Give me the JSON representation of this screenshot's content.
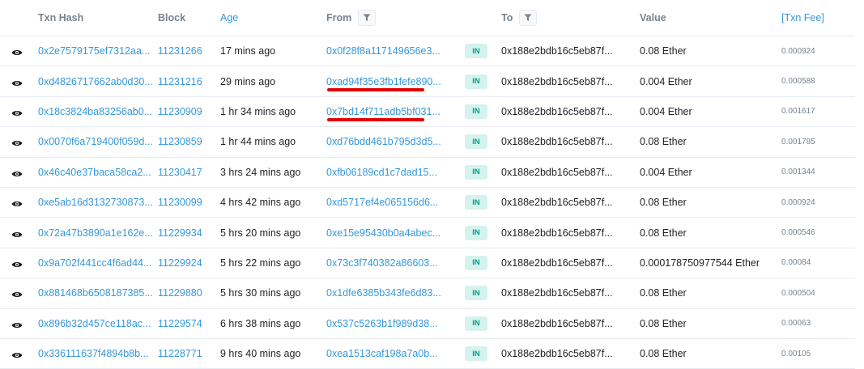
{
  "headers": {
    "txn_hash": "Txn Hash",
    "block": "Block",
    "age": "Age",
    "from": "From",
    "to": "To",
    "value": "Value",
    "txn_fee": "[Txn Fee]"
  },
  "colors": {
    "link": "#3498db",
    "in_badge_bg": "#d5f3ee",
    "in_badge_text": "#00a186",
    "annotation_red": "#e00000"
  },
  "rows": [
    {
      "hash": "0x2e7579175ef7312aa...",
      "block": "11231266",
      "age": "17 mins ago",
      "from": "0x0f28f8a117149656e3...",
      "direction": "IN",
      "to": "0x188e2bdb16c5eb87f...",
      "value": "0.08 Ether",
      "fee": "0.000924",
      "highlighted": false
    },
    {
      "hash": "0xd4826717662ab0d30...",
      "block": "11231216",
      "age": "29 mins ago",
      "from": "0xad94f35e3fb1fefe890...",
      "direction": "IN",
      "to": "0x188e2bdb16c5eb87f...",
      "value": "0.004 Ether",
      "fee": "0.000588",
      "highlighted": true
    },
    {
      "hash": "0x18c3824ba83256ab0...",
      "block": "11230909",
      "age": "1 hr 34 mins ago",
      "from": "0x7bd14f711adb5bf031...",
      "direction": "IN",
      "to": "0x188e2bdb16c5eb87f...",
      "value": "0.004 Ether",
      "fee": "0.001617",
      "highlighted": true
    },
    {
      "hash": "0x0070f6a719400f059d...",
      "block": "11230859",
      "age": "1 hr 44 mins ago",
      "from": "0xd76bdd461b795d3d5...",
      "direction": "IN",
      "to": "0x188e2bdb16c5eb87f...",
      "value": "0.08 Ether",
      "fee": "0.001785",
      "highlighted": false
    },
    {
      "hash": "0x46c40e37baca58ca2...",
      "block": "11230417",
      "age": "3 hrs 24 mins ago",
      "from": "0xfb06189cd1c7dad15...",
      "direction": "IN",
      "to": "0x188e2bdb16c5eb87f...",
      "value": "0.004 Ether",
      "fee": "0.001344",
      "highlighted": false
    },
    {
      "hash": "0xe5ab16d3132730873...",
      "block": "11230099",
      "age": "4 hrs 42 mins ago",
      "from": "0xd5717ef4e065156d6...",
      "direction": "IN",
      "to": "0x188e2bdb16c5eb87f...",
      "value": "0.08 Ether",
      "fee": "0.000924",
      "highlighted": false
    },
    {
      "hash": "0x72a47b3890a1e162e...",
      "block": "11229934",
      "age": "5 hrs 20 mins ago",
      "from": "0xe15e95430b0a4abec...",
      "direction": "IN",
      "to": "0x188e2bdb16c5eb87f...",
      "value": "0.08 Ether",
      "fee": "0.000546",
      "highlighted": false
    },
    {
      "hash": "0x9a702f441cc4f6ad44...",
      "block": "11229924",
      "age": "5 hrs 22 mins ago",
      "from": "0x73c3f740382a86603...",
      "direction": "IN",
      "to": "0x188e2bdb16c5eb87f...",
      "value": "0.000178750977544 Ether",
      "fee": "0.00084",
      "highlighted": false
    },
    {
      "hash": "0x881468b6508187385...",
      "block": "11229880",
      "age": "5 hrs 30 mins ago",
      "from": "0x1dfe6385b343fe6d83...",
      "direction": "IN",
      "to": "0x188e2bdb16c5eb87f...",
      "value": "0.08 Ether",
      "fee": "0.000504",
      "highlighted": false
    },
    {
      "hash": "0x896b32d457ce118ac...",
      "block": "11229574",
      "age": "6 hrs 38 mins ago",
      "from": "0x537c5263b1f989d38...",
      "direction": "IN",
      "to": "0x188e2bdb16c5eb87f...",
      "value": "0.08 Ether",
      "fee": "0.00063",
      "highlighted": false
    },
    {
      "hash": "0x336111637f4894b8b...",
      "block": "11228771",
      "age": "9 hrs 40 mins ago",
      "from": "0xea1513caf198a7a0b...",
      "direction": "IN",
      "to": "0x188e2bdb16c5eb87f...",
      "value": "0.08 Ether",
      "fee": "0.00105",
      "highlighted": false
    }
  ]
}
